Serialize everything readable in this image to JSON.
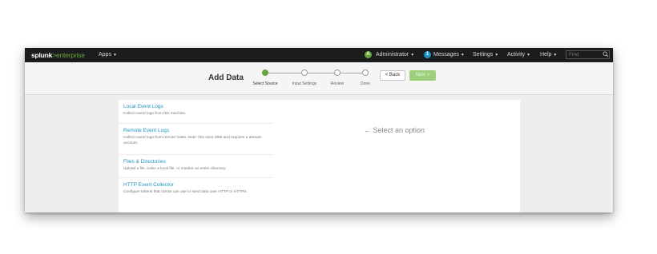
{
  "topbar": {
    "logo": {
      "brand": "splunk",
      "suffix": ">enterprise"
    },
    "apps_label": "Apps",
    "admin_badge": "A",
    "admin_label": "Administrator",
    "messages_badge": "1",
    "messages_label": "Messages",
    "settings_label": "Settings",
    "activity_label": "Activity",
    "help_label": "Help",
    "find_placeholder": "Find"
  },
  "header": {
    "title": "Add Data",
    "steps": [
      {
        "label": "Select Source",
        "active": true
      },
      {
        "label": "Input Settings",
        "active": false
      },
      {
        "label": "Review",
        "active": false
      },
      {
        "label": "Done",
        "active": false
      }
    ],
    "back_label": "< Back",
    "next_label": "Next >"
  },
  "sources": [
    {
      "title": "Local Event Logs",
      "description": "Collect event logs from this machine."
    },
    {
      "title": "Remote Event Logs",
      "description": "Collect event logs from remote hosts. Note: this uses WMI and requires a domain account."
    },
    {
      "title": "Files & Directories",
      "description": "Upload a file, index a local file, or monitor an entire directory."
    },
    {
      "title": "HTTP Event Collector",
      "description": "Configure tokens that clients can use to send data over HTTP or HTTPS."
    }
  ],
  "detail": {
    "hint": "← Select an option"
  },
  "colors": {
    "brand_green": "#65a637",
    "link_blue": "#1e93c6",
    "topbar_bg": "#1a1c1e"
  }
}
